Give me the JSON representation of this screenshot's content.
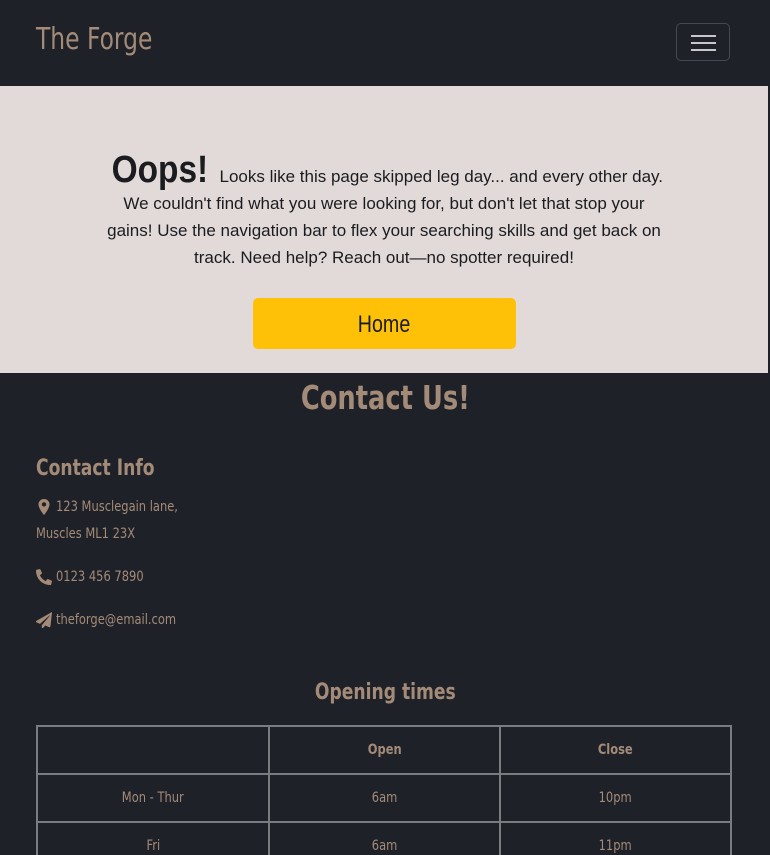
{
  "nav": {
    "brand": "The Forge",
    "toggler_icon": "hamburger-menu-icon"
  },
  "hero": {
    "oops": "Oops!",
    "message": "Looks like this page skipped leg day... and every other day. We couldn't find what you were looking for, but don't let that stop your gains! Use the navigation bar to flex your searching skills and get back on track. Need help? Reach out—no spotter required!",
    "home_button": "Home",
    "button_color": "#ffc107",
    "background_color": "#e2d9d9"
  },
  "contact": {
    "title": "Contact Us!",
    "info_title": "Contact Info",
    "address_line1": "123 Musclegain lane,",
    "address_line2": "Muscles ML1 23X",
    "phone": "0123 456 7890",
    "email": "theforge@email.com",
    "icons": {
      "address": "map-marker-icon",
      "phone": "phone-icon",
      "email": "paper-plane-icon"
    }
  },
  "hours": {
    "title": "Opening times",
    "headers": [
      "",
      "Open",
      "Close"
    ],
    "rows": [
      [
        "Mon - Thur",
        "6am",
        "10pm"
      ],
      [
        "Fri",
        "6am",
        "11pm"
      ]
    ]
  },
  "colors": {
    "page_background": "#1f2129",
    "accent_text": "#a38b78"
  }
}
